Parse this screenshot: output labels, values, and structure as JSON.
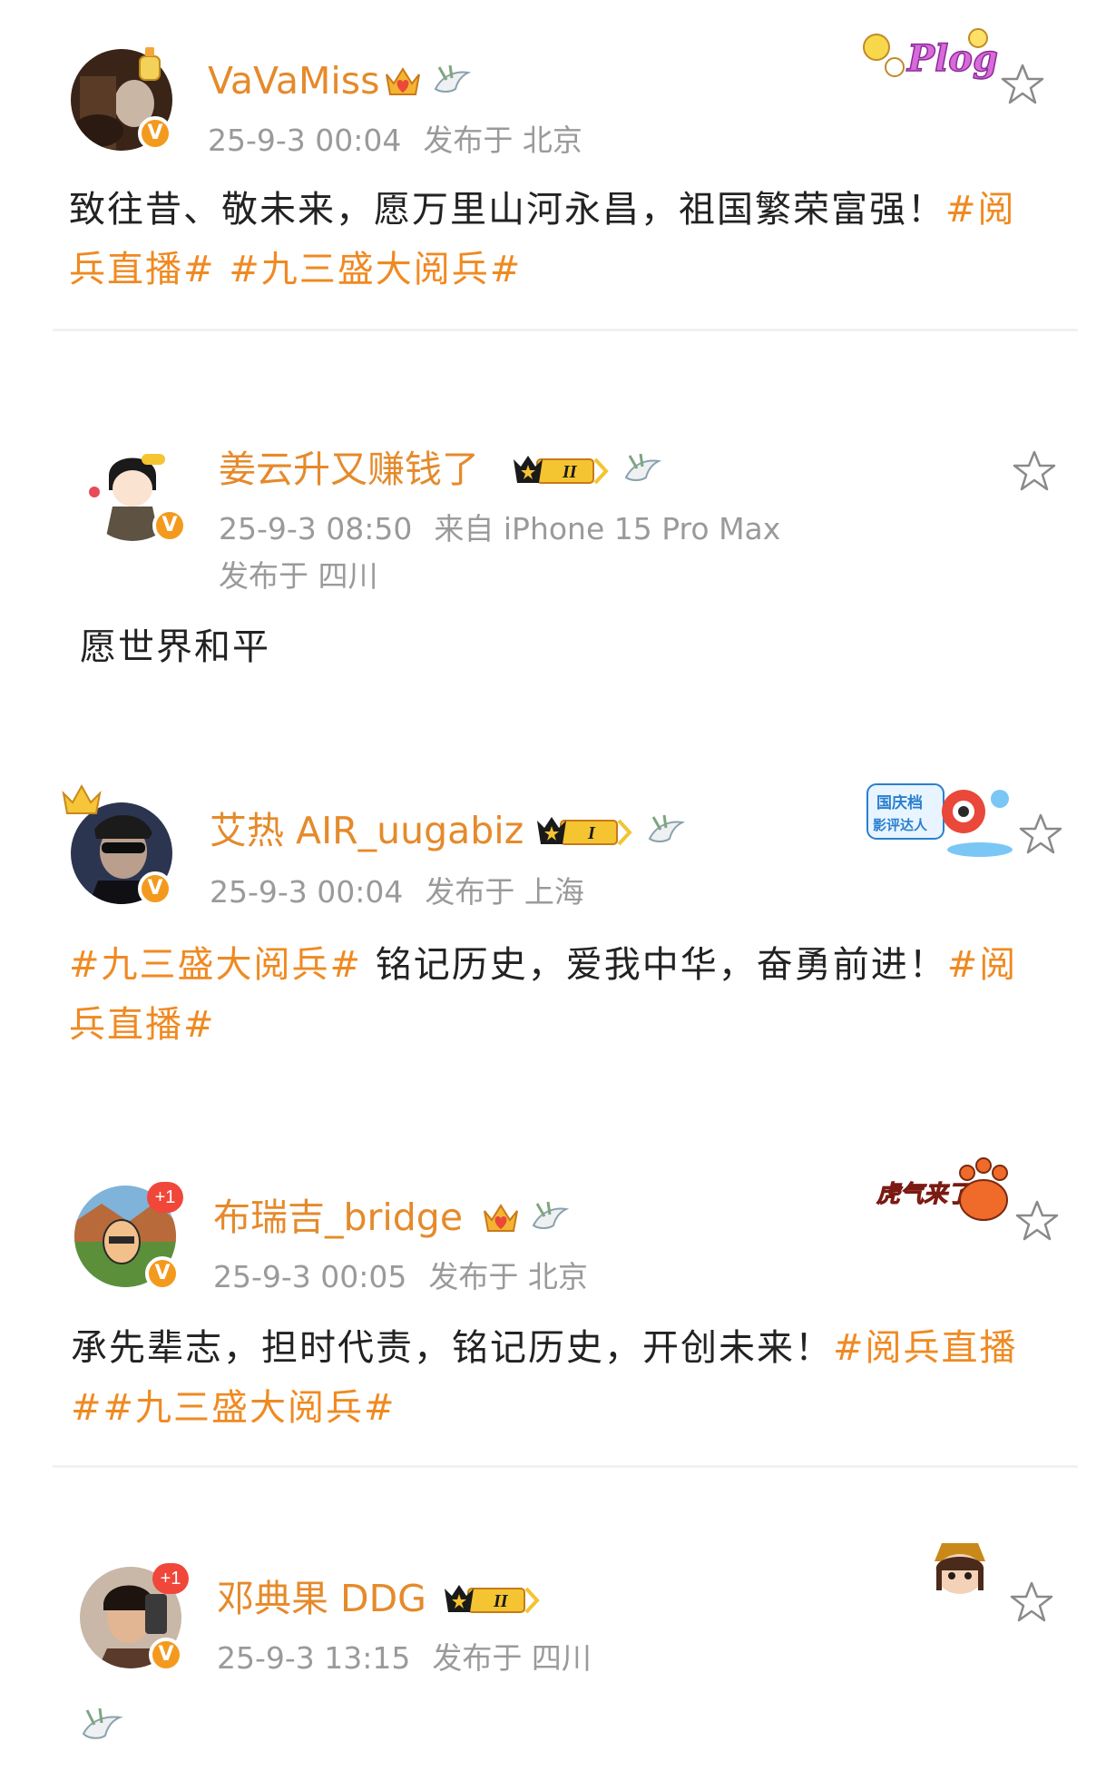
{
  "posts": [
    {
      "username": "VaVaMiss",
      "timestamp": "25-9-3 00:04",
      "location": "发布于 北京",
      "content_text": "致往昔、敬未来，愿万里山河永昌，祖国繁荣富强！",
      "tag_1_part1": "#阅",
      "tag_1_part2": "兵直播#",
      "tag_2": "#九三盛大阅兵#",
      "badge": "crown-heart-icon",
      "sticker": "Plog"
    },
    {
      "username": "姜云升又赚钱了",
      "timestamp": "25-9-3 08:50",
      "source": "来自 iPhone 15 Pro Max",
      "location": "发布于 四川",
      "content_text": "愿世界和平",
      "level_badge": "II"
    },
    {
      "username": "艾热 AIR_uugabiz",
      "timestamp": "25-9-3 00:04",
      "location": "发布于 上海",
      "tag_1": "#九三盛大阅兵#",
      "content_text": " 铭记历史，爱我中华，奋勇前进！",
      "tag_2_part1": "#阅",
      "tag_2_part2": "兵直播#",
      "level_badge": "I",
      "sticker_line1": "国庆档",
      "sticker_line2": "影评达人"
    },
    {
      "username": "布瑞吉_bridge",
      "timestamp": "25-9-3 00:05",
      "location": "发布于 北京",
      "content_text": "承先辈志，担时代责，铭记历史，开创未来！",
      "tag_1": "#阅兵直播",
      "tag_2": "##九三盛大阅兵#",
      "plus_one": "+1",
      "sticker": "虎气来了"
    },
    {
      "username": "邓典果 DDG",
      "timestamp": "25-9-3 13:15",
      "location": "发布于 四川",
      "plus_one": "+1",
      "level_badge": "II"
    }
  ],
  "verified_mark": "V",
  "colors": {
    "username": "#e58a2b",
    "hashtag": "#ef8a22",
    "meta": "#9a9a9a",
    "verified": "#f39a1e"
  }
}
